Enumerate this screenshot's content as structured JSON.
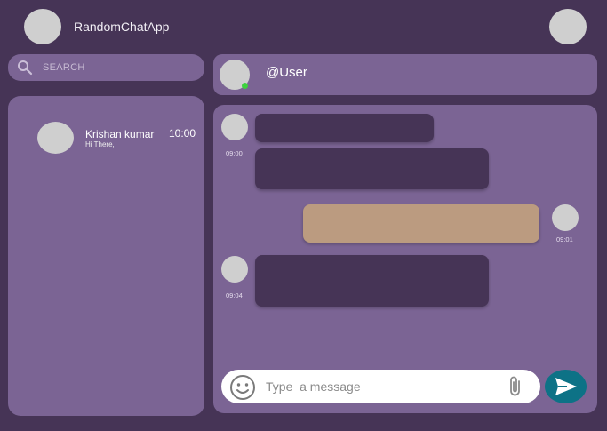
{
  "app": {
    "title": "RandomChatApp"
  },
  "search": {
    "placeholder": "SEARCH"
  },
  "contacts": [
    {
      "name": "Krishan kumar",
      "time": "10:00",
      "preview": "Hi There,"
    }
  ],
  "chat_header": {
    "user": "@User",
    "status": "online"
  },
  "messages": [
    {
      "direction": "incoming",
      "time": "09:00"
    },
    {
      "direction": "outgoing",
      "time": "09:01"
    },
    {
      "direction": "incoming",
      "time": "09:04"
    }
  ],
  "composer": {
    "placeholder": "Type  a message"
  },
  "icons": {
    "search": "search-icon",
    "emoji": "emoji-icon",
    "attach": "paperclip-icon",
    "send": "send-icon"
  },
  "colors": {
    "background": "#463456",
    "panel": "#7b6494",
    "bubble_incoming": "#463456",
    "bubble_outgoing": "#bb9b80",
    "send_button": "#0d7286",
    "online": "#3ed13e"
  }
}
